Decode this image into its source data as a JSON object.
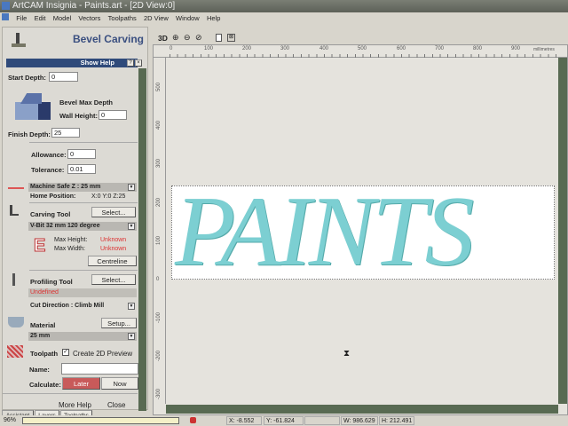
{
  "window": {
    "title": "ArtCAM Insignia - Paints.art - [2D View:0]"
  },
  "menu": [
    "File",
    "Edit",
    "Model",
    "Vectors",
    "Toolpaths",
    "2D View",
    "Window",
    "Help"
  ],
  "view_toolbar": {
    "mode_3d": "3D"
  },
  "panel": {
    "title": "Bevel Carving",
    "show_help": "Show Help",
    "help_btn": "?",
    "close_btn": "×",
    "start_depth_label": "Start Depth:",
    "start_depth": "0",
    "bevel_max_depth": "Bevel Max Depth",
    "wall_height_label": "Wall Height:",
    "wall_height": "0",
    "finish_depth_label": "Finish Depth:",
    "finish_depth": "25",
    "allowance_label": "Allowance:",
    "allowance": "0",
    "tolerance_label": "Tolerance:",
    "tolerance": "0.01",
    "machine_safe_z": "Machine Safe Z : 25 mm",
    "home_position_label": "Home Position:",
    "home_position": "X:0 Y:0 Z:25",
    "carving_tool_label": "Carving Tool",
    "select": "Select...",
    "carving_tool": "V-Bit 32 mm 120 degree",
    "max_height_label": "Max Height:",
    "max_height": "Unknown",
    "max_width_label": "Max Width:",
    "max_width": "Unknown",
    "centreline": "Centreline",
    "profiling_tool_label": "Profiling Tool",
    "profiling_tool": "Undefined",
    "cut_direction": "Cut Direction : Climb Mill",
    "material_label": "Material",
    "setup": "Setup...",
    "material": "25 mm",
    "toolpath_label": "Toolpath",
    "create_preview": "Create 2D Preview",
    "create_preview_checked": true,
    "name_label": "Name:",
    "name_value": "",
    "calculate_label": "Calculate:",
    "later": "Later",
    "now": "Now",
    "more_help": "More Help",
    "close": "Close"
  },
  "tabs": [
    "Assistant",
    "Layers",
    "Toolpaths"
  ],
  "ruler": {
    "top": [
      "0",
      "100",
      "200",
      "300",
      "400",
      "500",
      "600",
      "700",
      "800",
      "900"
    ],
    "units": "millimetres",
    "left": [
      "500",
      "400",
      "300",
      "200",
      "100",
      "0",
      "-100",
      "-200",
      "-300"
    ]
  },
  "canvas": {
    "text": "PAINTS",
    "color": "#7ccfd2"
  },
  "status": {
    "zoom": "96%",
    "x": "X: -8.552",
    "y": "Y: -61.824",
    "w": "W: 986.629",
    "h": "H: 212.491"
  }
}
